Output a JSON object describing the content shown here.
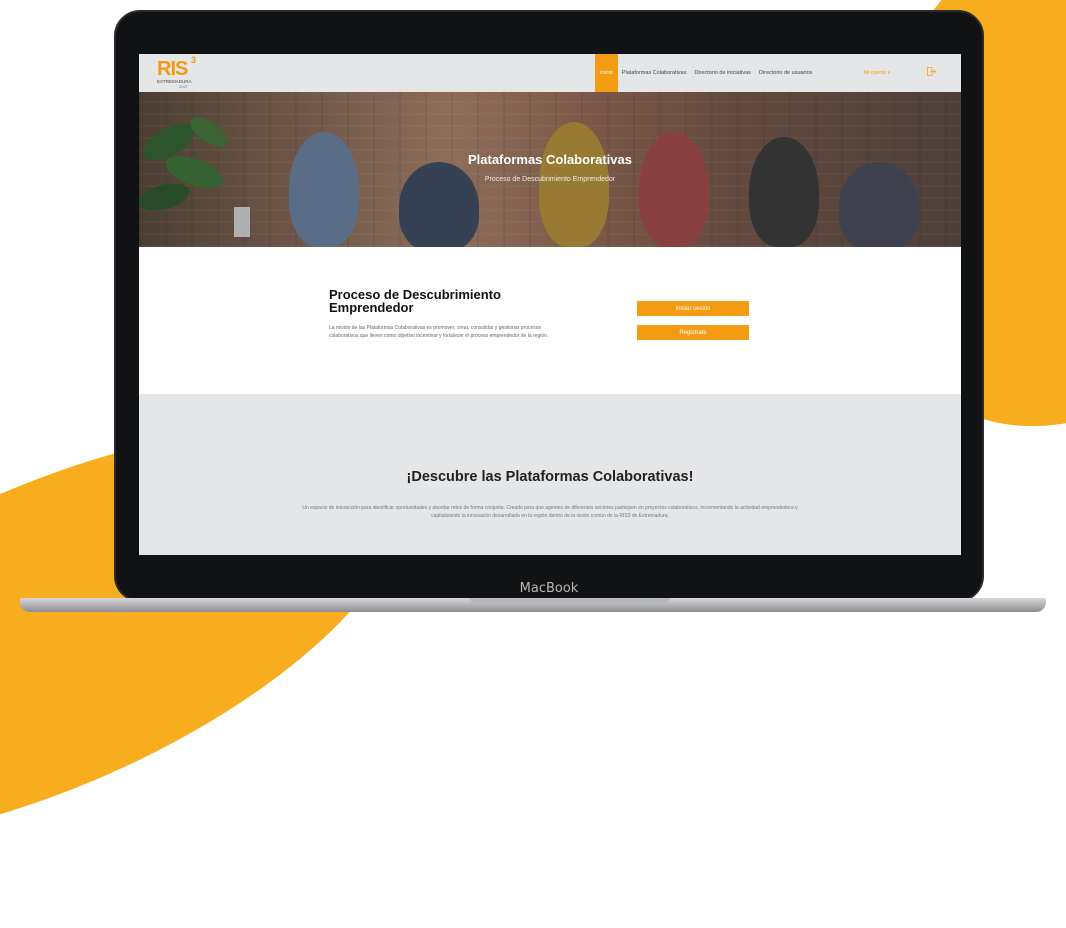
{
  "device": {
    "label": "MacBook"
  },
  "header": {
    "logo": {
      "main": "RIS",
      "sup": "3",
      "sub": "EXTREMADURA",
      "year": "2027"
    },
    "nav": [
      {
        "label": "Inicio",
        "active": true
      },
      {
        "label": "Plataformas Colaborativas",
        "active": false
      },
      {
        "label": "Directorio de iniciativas",
        "active": false
      },
      {
        "label": "Directorio de usuarios",
        "active": false
      }
    ],
    "language": "Mi cuenta ∨",
    "logout_icon": "logout-icon"
  },
  "hero": {
    "title": "Plataformas Colaborativas",
    "subtitle": "Proceso de Descubrimiento Emprendedor"
  },
  "intro": {
    "title": "Proceso de Descubrimiento Emprendedor",
    "text": "La misión de las Plataformas Colaborativas es promover, crear, consolidar y gestionar procesos colaborativos que lleven como objetivo incentivar y fortalecer el proceso emprendedor de la región.",
    "login_button": "Iniciar sesión",
    "register_button": "Registrate"
  },
  "discover": {
    "title": "¡Descubre las Plataformas Colaborativas!",
    "text": "Un espacio de interacción para identificar oportunidades y abordar retos de forma conjunta. Creado para que agentes de diferentes sectores participen en proyectos colaborativos, incrementando la actividad emprendedora y capitalizando la innovación desarrollada en la región dentro de la visión común de la RIS3 de Extremadura."
  },
  "colors": {
    "accent": "#f39c12",
    "brand_swoosh": "#f7ad1e",
    "header_bg": "#e4e6e8"
  }
}
